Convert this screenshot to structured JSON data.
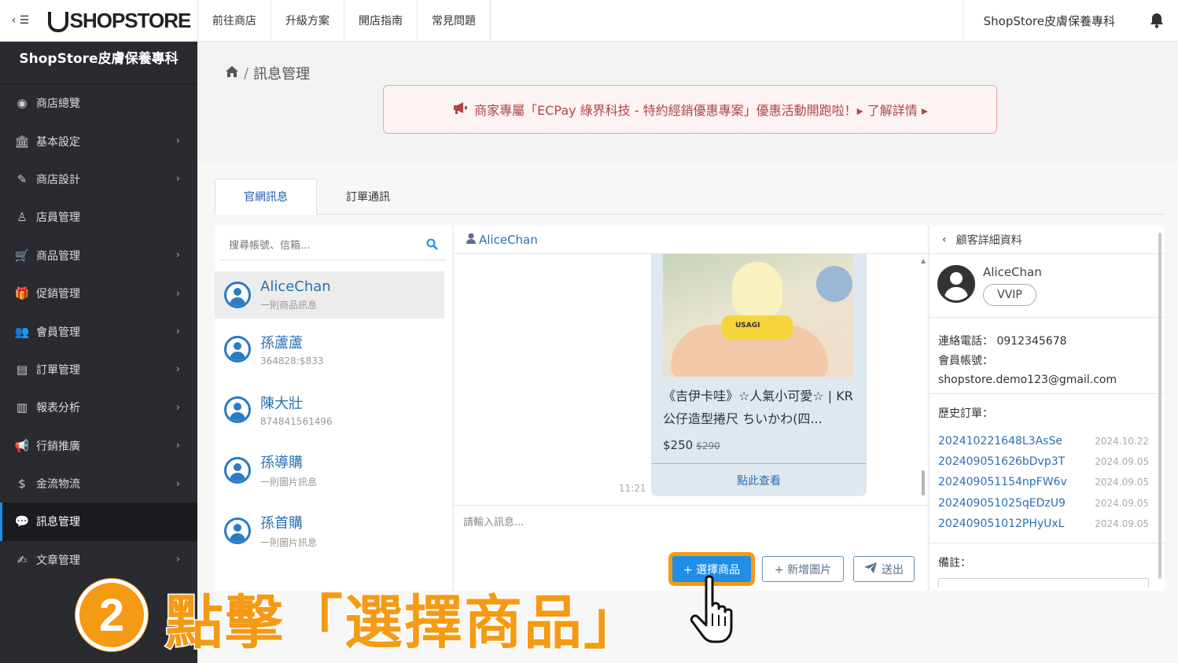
{
  "topbar": {
    "toggle_label": "‹ ☰",
    "logo_text": "SHOPSTORE",
    "nav": [
      "前往商店",
      "升級方案",
      "開店指南",
      "常見問題"
    ],
    "store_name": "ShopStore皮膚保養專科"
  },
  "sidebar": {
    "title": "ShopStore皮膚保養專科",
    "items": [
      {
        "label": "商店總覽",
        "icon": "dashboard-icon",
        "glyph": "◉",
        "submenu": false
      },
      {
        "label": "基本設定",
        "icon": "bank-icon",
        "glyph": "🏛",
        "submenu": true
      },
      {
        "label": "商店設計",
        "icon": "magic-wand-icon",
        "glyph": "✎",
        "submenu": true
      },
      {
        "label": "店員管理",
        "icon": "staff-icon",
        "glyph": "♙",
        "submenu": false
      },
      {
        "label": "商品管理",
        "icon": "cart-icon",
        "glyph": "🛒",
        "submenu": true
      },
      {
        "label": "促銷管理",
        "icon": "gift-icon",
        "glyph": "🎁",
        "submenu": true
      },
      {
        "label": "會員管理",
        "icon": "users-icon",
        "glyph": "👥",
        "submenu": true
      },
      {
        "label": "訂單管理",
        "icon": "order-icon",
        "glyph": "▤",
        "submenu": true
      },
      {
        "label": "報表分析",
        "icon": "chart-icon",
        "glyph": "▥",
        "submenu": true
      },
      {
        "label": "行銷推廣",
        "icon": "megaphone-icon",
        "glyph": "📢",
        "submenu": true
      },
      {
        "label": "金流物流",
        "icon": "dollar-icon",
        "glyph": "$",
        "submenu": true
      },
      {
        "label": "訊息管理",
        "icon": "chat-icon",
        "glyph": "💬",
        "submenu": false
      },
      {
        "label": "文章管理",
        "icon": "edit-icon",
        "glyph": "✍",
        "submenu": true
      }
    ],
    "active_index": 11
  },
  "breadcrumb": {
    "sep": "/",
    "current": "訊息管理"
  },
  "promo": {
    "text": "商家專屬「ECPay 綠界科技 - 特約經銷優惠專案」優惠活動開跑啦！▸ 了解詳情 ▸"
  },
  "tabs": [
    "官網訊息",
    "訂單通訊"
  ],
  "search": {
    "placeholder": "搜尋帳號、信箱..."
  },
  "contacts": [
    {
      "name": "AliceChan",
      "sub": "一則商品訊息"
    },
    {
      "name": "孫蘆蘆",
      "sub": "364828:$833"
    },
    {
      "name": "陳大壯",
      "sub": "874841561496"
    },
    {
      "name": "孫導購",
      "sub": "一則圖片訊息"
    },
    {
      "name": "孫首購",
      "sub": "一則圖片訊息"
    }
  ],
  "chat": {
    "header_name": "AliceChan",
    "product_title": "《吉伊卡哇》☆人氣小可愛☆ | KR公仔造型捲尺 ちいかわ(四...",
    "product_image_label": "USAGI",
    "price": "$250",
    "original_price": "$290",
    "view_label": "點此查看",
    "time": "11:21",
    "input_placeholder": "請輸入訊息...",
    "btn_select": "+ 選擇商品",
    "btn_image": "+ 新增圖片",
    "btn_send": "送出"
  },
  "detail": {
    "header": "顧客詳細資料",
    "name": "AliceChan",
    "level": "VVIP",
    "phone_line": "連絡電話： 0912345678",
    "account_label": "會員帳號：",
    "email": "shopstore.demo123@gmail.com",
    "orders_label": "歷史訂單：",
    "orders": [
      {
        "no": "202410221648L3AsSe",
        "date": "2024.10.22"
      },
      {
        "no": "202409051626bDvp3T",
        "date": "2024.09.05"
      },
      {
        "no": "202409051154npFW6v",
        "date": "2024.09.05"
      },
      {
        "no": "202409051025qEDzU9",
        "date": "2024.09.05"
      },
      {
        "no": "202409051012PHyUxL",
        "date": "2024.09.05"
      }
    ],
    "note_label": "備註："
  },
  "annotation": {
    "step": "2",
    "text": "點擊「選擇商品」"
  },
  "colors": {
    "accent_blue": "#1f8ee6",
    "highlight_orange": "#f59a14",
    "sidebar_bg": "#292b30",
    "promo_red": "#b14646"
  }
}
